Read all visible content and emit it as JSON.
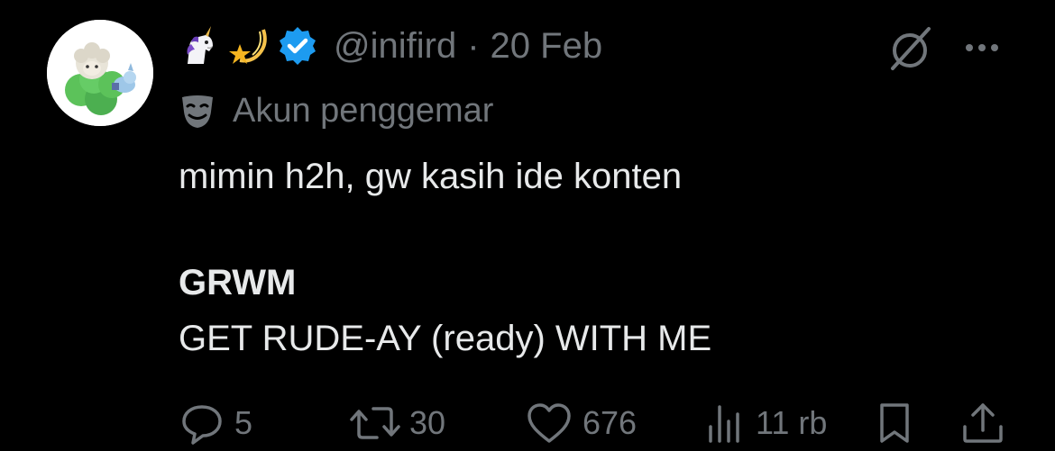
{
  "author": {
    "handle": "@inifird",
    "separator": "·",
    "date": "20 Feb",
    "badge_icons": [
      "unicorn-emoji",
      "shooting-star-emoji",
      "verified-badge"
    ],
    "account_label": "Akun penggemar",
    "account_icon": "performing-arts-mask-icon"
  },
  "tweet": {
    "line1": "mimin h2h, gw kasih ide konten",
    "line2": "GRWM",
    "line3": "GET RUDE-AY (ready) WITH ME"
  },
  "actions": {
    "replies": "5",
    "reposts": "30",
    "likes": "676",
    "views": "11 rb"
  },
  "colors": {
    "background": "#000000",
    "text": "#e7e9ea",
    "muted": "#71767b",
    "verified": "#1d9bf0"
  }
}
